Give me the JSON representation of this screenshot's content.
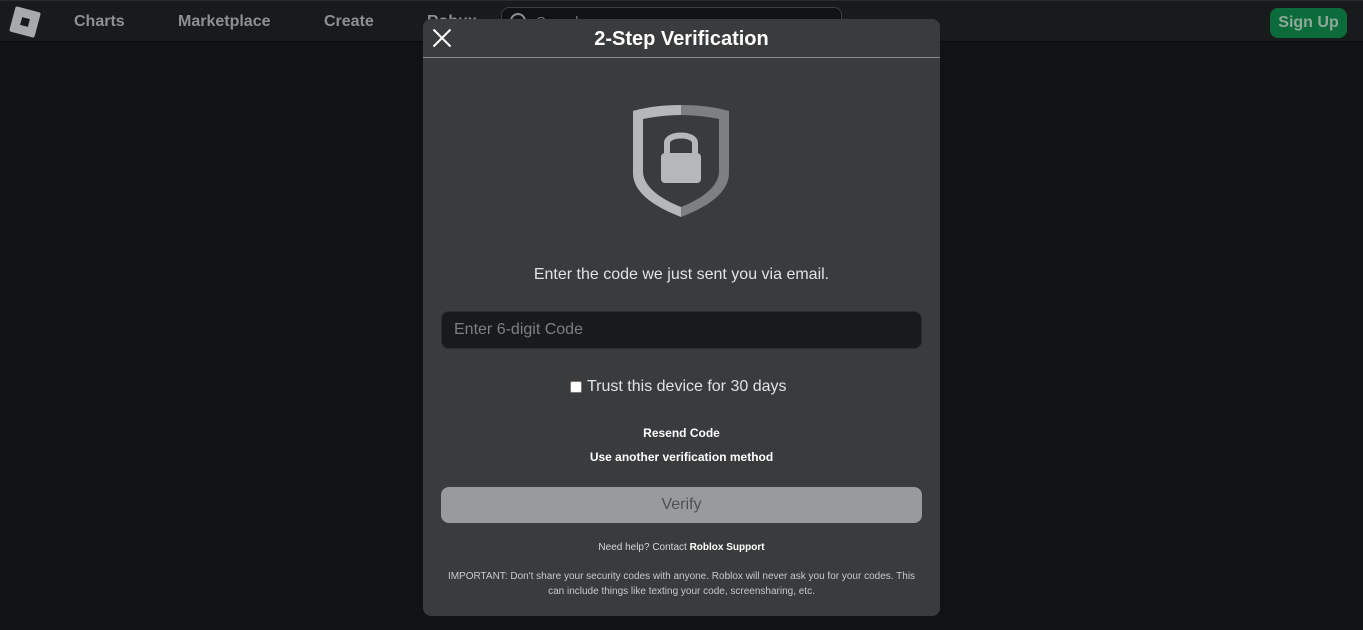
{
  "nav": {
    "logo_icon": "roblox-logo-icon",
    "links": [
      "Charts",
      "Marketplace",
      "Create",
      "Robux"
    ],
    "search_placeholder": "Search",
    "signup_label": "Sign Up"
  },
  "modal": {
    "title": "2-Step Verification",
    "close_icon": "close-icon",
    "shield_icon": "shield-lock-icon",
    "instructions": "Enter the code we just sent you via email.",
    "code_placeholder": "Enter 6-digit Code",
    "code_value": "",
    "trust_label": "Trust this device for 30 days",
    "trust_checked": false,
    "resend_label": "Resend Code",
    "another_method_label": "Use another verification method",
    "verify_label": "Verify",
    "help_prefix": "Need help? Contact ",
    "help_link": "Roblox Support",
    "important": "IMPORTANT: Don't share your security codes with anyone. Roblox will never ask you for your codes. This can include things like texting your code, screensharing, etc."
  },
  "colors": {
    "page_bg": "#111213",
    "modal_bg": "#393b3d",
    "signup_bg": "#0b6b3a",
    "verify_bg": "#999a9b"
  }
}
